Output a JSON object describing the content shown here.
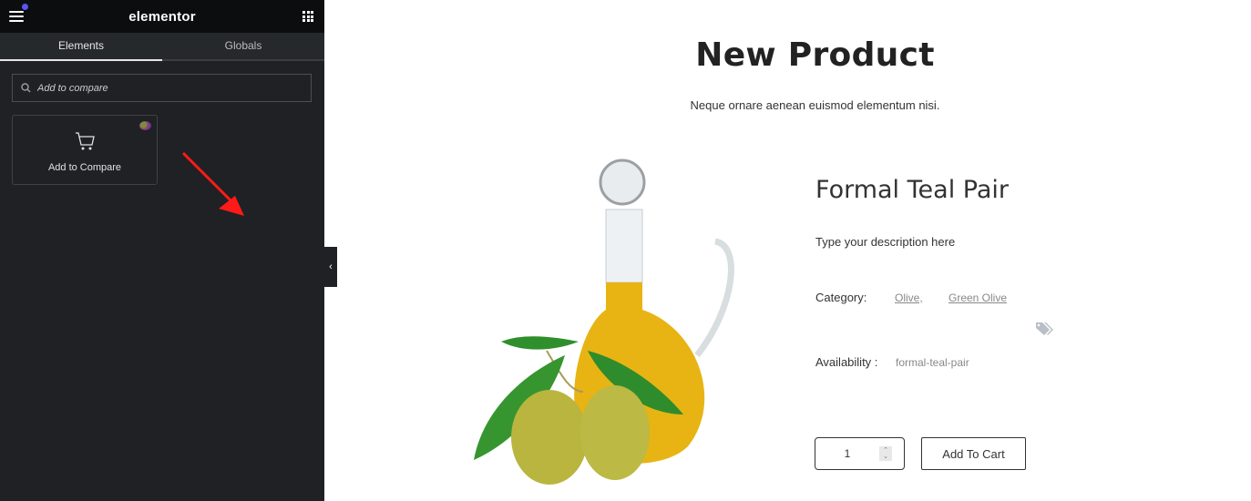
{
  "editor": {
    "logo": "elementor",
    "menu_icon": "hamburger-menu-icon",
    "apps_icon": "apps-grid-icon",
    "tabs": [
      {
        "label": "Elements",
        "active": true
      },
      {
        "label": "Globals",
        "active": false
      }
    ],
    "search": {
      "value": "",
      "placeholder": "Add to compare"
    },
    "widgets": [
      {
        "label": "Add to Compare",
        "icon": "cart-icon"
      }
    ],
    "collapse_icon": "chevron-left-icon",
    "colors": {
      "panel_bg": "#1f2124",
      "topbar_bg": "#0c0d0e",
      "notification_dot": "#5a54f5",
      "annotation_arrow": "#ff1a1a"
    }
  },
  "page": {
    "title": "New Product",
    "subtitle": "Neque ornare aenean euismod elementum nisi.",
    "product": {
      "name": "Formal Teal Pair",
      "description": "Type your description here",
      "category_label": "Category:",
      "categories": [
        "Olive,",
        "Green Olive"
      ],
      "availability_label": "Availability :",
      "availability_value": "formal-teal-pair",
      "quantity": "1",
      "add_to_cart_label": "Add To Cart",
      "image_alt": "Olive oil carafe with green olives"
    }
  }
}
